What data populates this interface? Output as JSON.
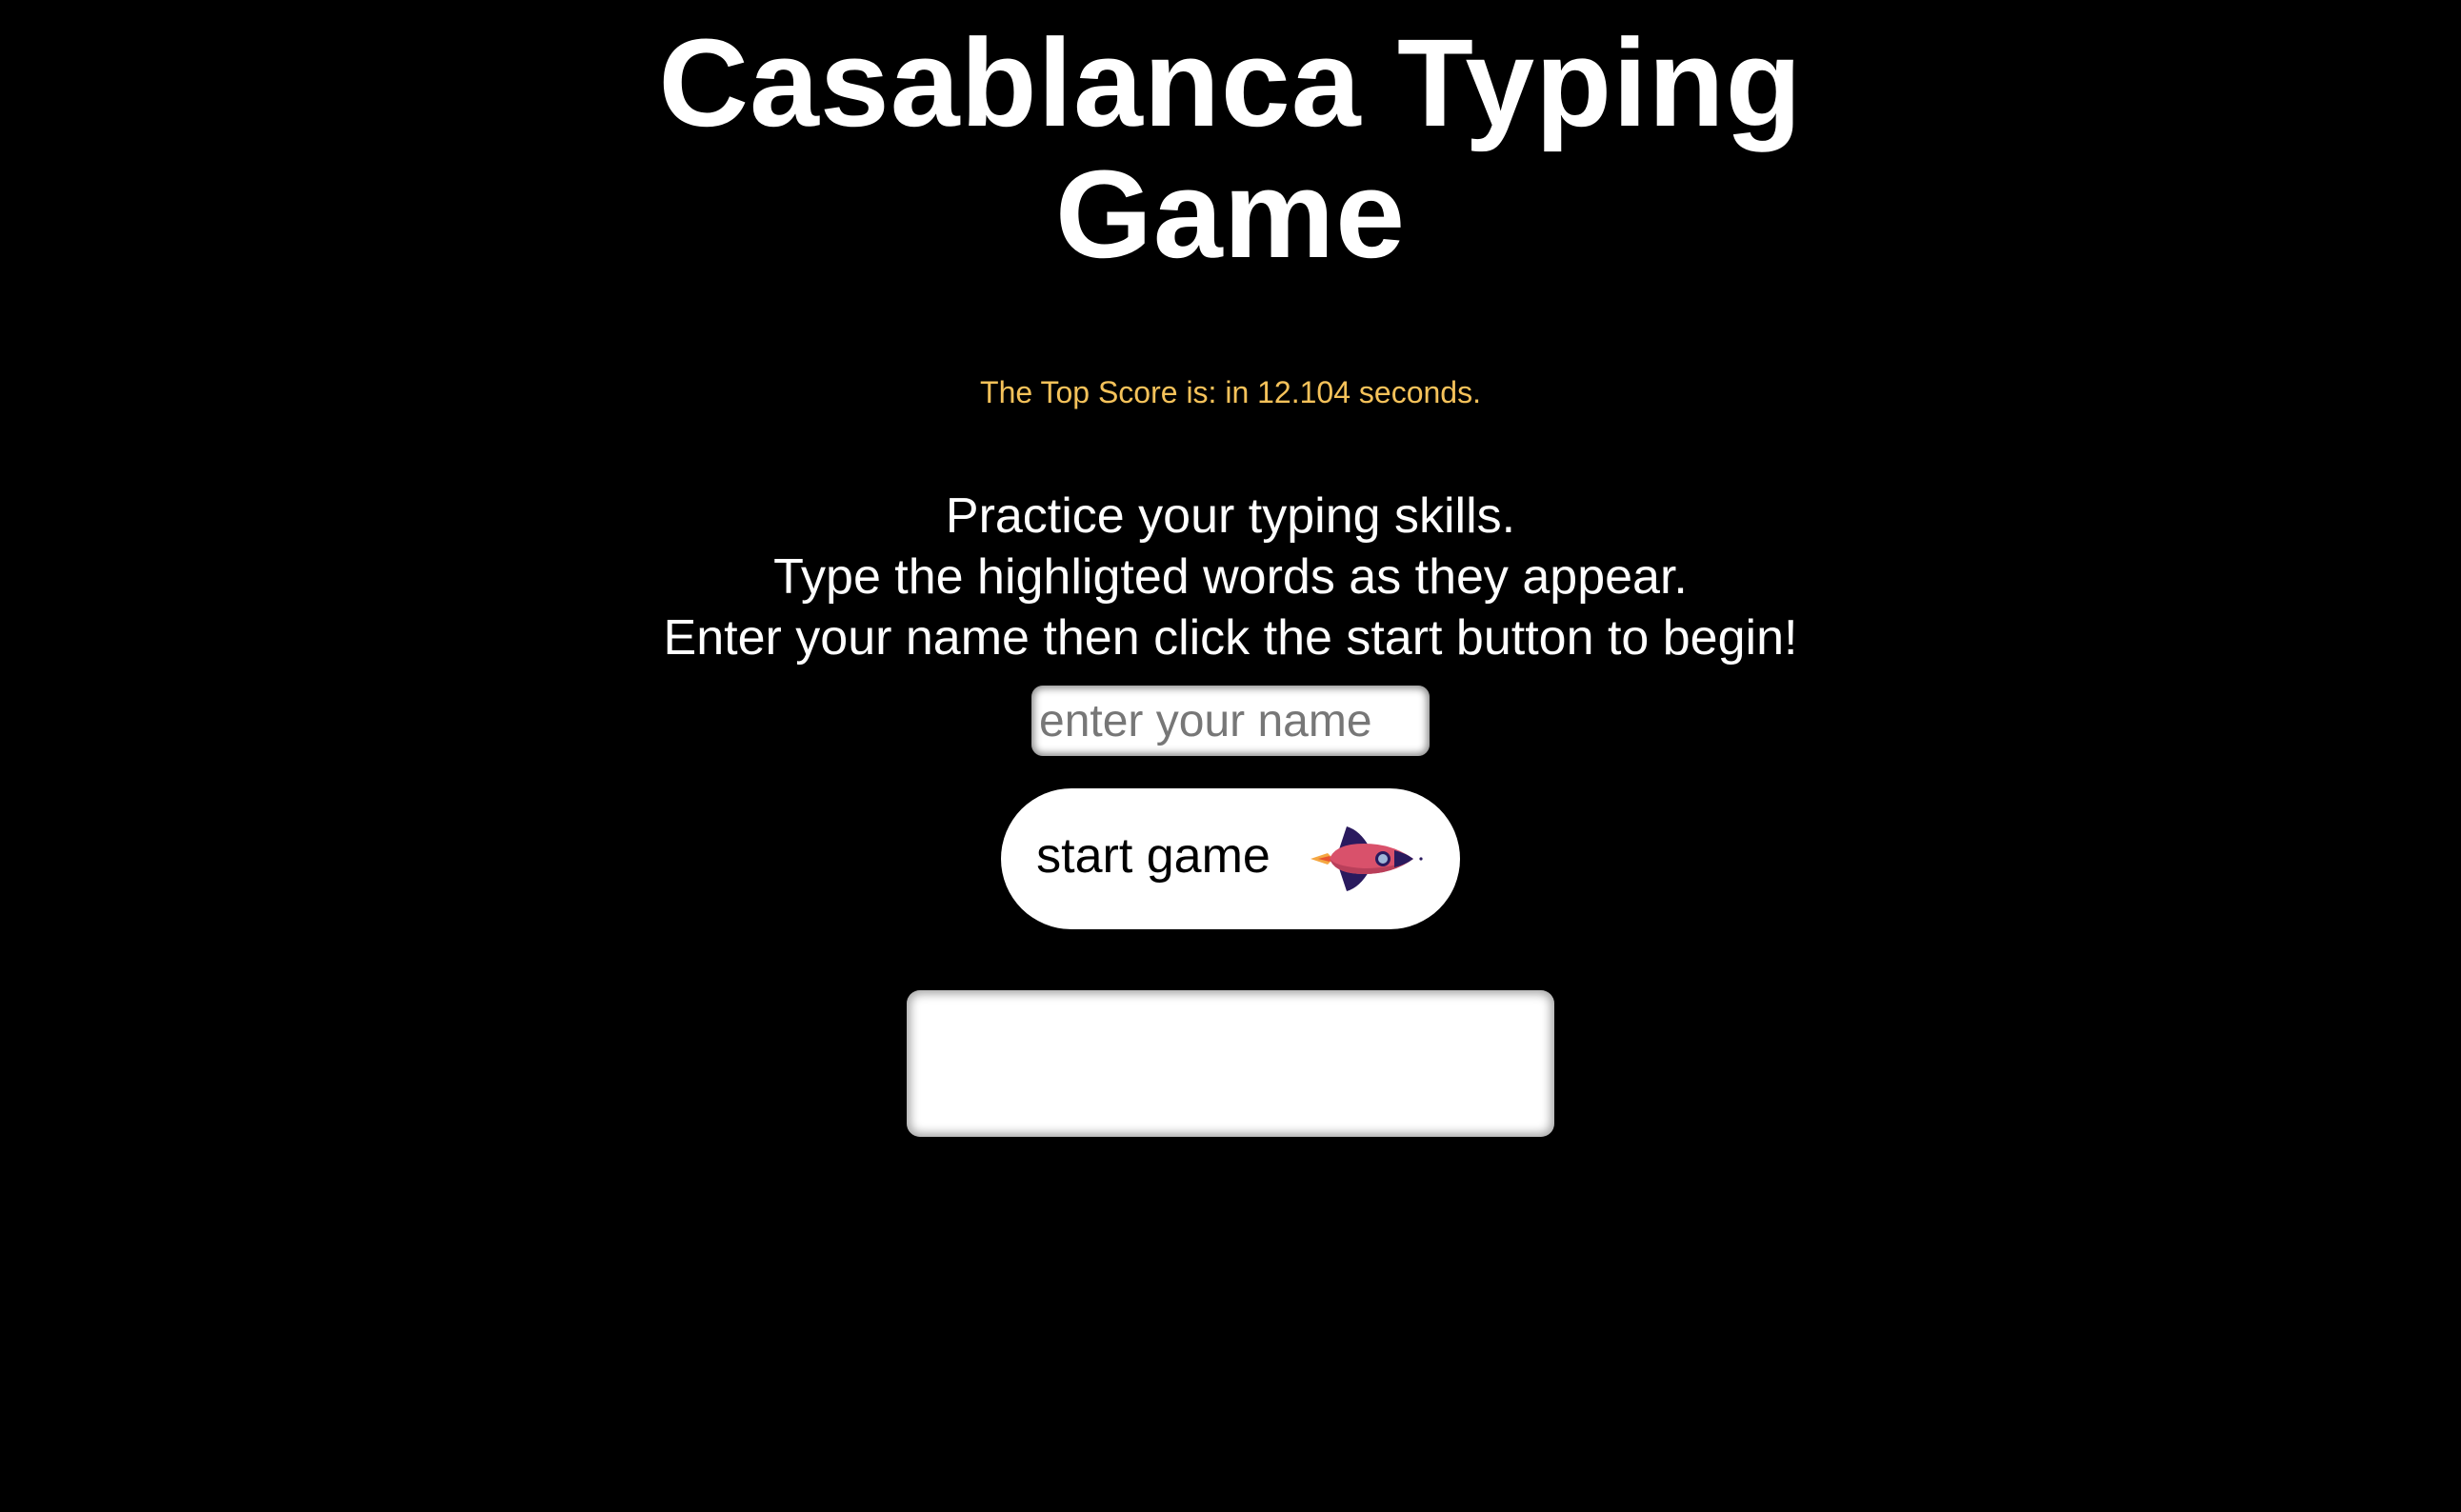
{
  "header": {
    "title_line1": "Casablanca Typing",
    "title_line2": "Game"
  },
  "score": {
    "top_score_text": "The Top Score is: in 12.104 seconds."
  },
  "instructions": {
    "line1": "Practice your typing skills.",
    "line2": "Type the highligted words as they appear.",
    "line3": "Enter your name then click the start button to begin!"
  },
  "name_input": {
    "placeholder": "enter your name",
    "value": ""
  },
  "start_button": {
    "label": "start game",
    "icon": "rocket-icon"
  },
  "word_display": {
    "text": ""
  },
  "colors": {
    "background": "#000000",
    "title": "#ffffff",
    "top_score": "#f5c25a",
    "rocket_body": "#d9516b",
    "rocket_fins": "#2a1a5e",
    "rocket_flame": "#f4a742"
  }
}
